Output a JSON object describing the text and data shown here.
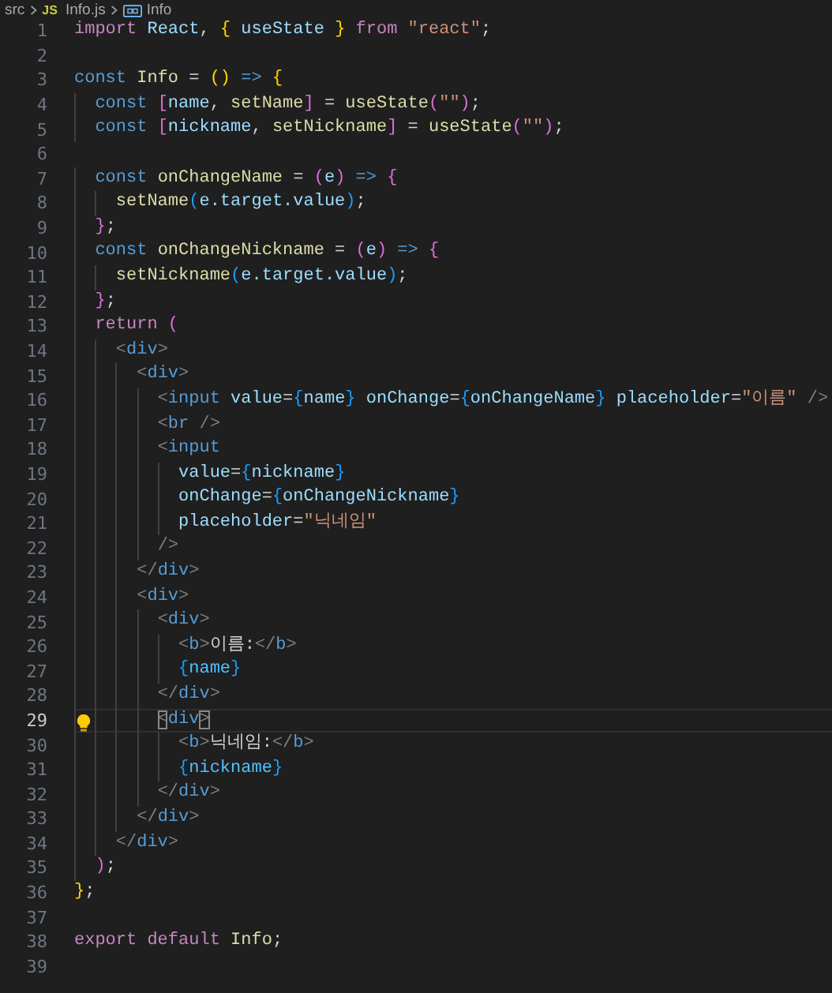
{
  "breadcrumb": {
    "folder": "src",
    "file_badge": "JS",
    "file": "Info.js",
    "symbol": "Info"
  },
  "lines": [
    {
      "n": "1",
      "current": false,
      "tokens": [
        {
          "kind": "kw",
          "text": "import "
        },
        {
          "kind": "var",
          "text": "React"
        },
        {
          "kind": "p",
          "text": ", "
        },
        {
          "kind": "b1",
          "text": "{"
        },
        {
          "kind": "var",
          "text": " useState "
        },
        {
          "kind": "b1",
          "text": "}"
        },
        {
          "kind": "kw",
          "text": " from "
        },
        {
          "kind": "str",
          "text": "\"react\""
        },
        {
          "kind": "p",
          "text": ";"
        }
      ]
    },
    {
      "n": "2",
      "current": false
    },
    {
      "n": "3",
      "current": false,
      "tokens": [
        {
          "kind": "st",
          "text": "const "
        },
        {
          "kind": "fn",
          "text": "Info"
        },
        {
          "kind": "p",
          "text": " = "
        },
        {
          "kind": "b1",
          "text": "()"
        },
        {
          "kind": "st",
          "text": " => "
        },
        {
          "kind": "b1",
          "text": "{"
        }
      ]
    },
    {
      "n": "4",
      "current": false,
      "tokens": [
        {
          "kind": "st",
          "text": "  const "
        },
        {
          "kind": "b2",
          "text": "["
        },
        {
          "kind": "var",
          "text": "name"
        },
        {
          "kind": "p",
          "text": ", "
        },
        {
          "kind": "fn",
          "text": "setName"
        },
        {
          "kind": "b2",
          "text": "]"
        },
        {
          "kind": "p",
          "text": " = "
        },
        {
          "kind": "fn",
          "text": "useState"
        },
        {
          "kind": "b2",
          "text": "("
        },
        {
          "kind": "str",
          "text": "\"\""
        },
        {
          "kind": "b2",
          "text": ")"
        },
        {
          "kind": "p",
          "text": ";"
        }
      ]
    },
    {
      "n": "5",
      "current": false,
      "tokens": [
        {
          "kind": "st",
          "text": "  const "
        },
        {
          "kind": "b2",
          "text": "["
        },
        {
          "kind": "var",
          "text": "nickname"
        },
        {
          "kind": "p",
          "text": ", "
        },
        {
          "kind": "fn",
          "text": "setNickname"
        },
        {
          "kind": "b2",
          "text": "]"
        },
        {
          "kind": "p",
          "text": " = "
        },
        {
          "kind": "fn",
          "text": "useState"
        },
        {
          "kind": "b2",
          "text": "("
        },
        {
          "kind": "str",
          "text": "\"\""
        },
        {
          "kind": "b2",
          "text": ")"
        },
        {
          "kind": "p",
          "text": ";"
        }
      ]
    },
    {
      "n": "6",
      "current": false
    },
    {
      "n": "7",
      "current": false,
      "tokens": [
        {
          "kind": "st",
          "text": "  const "
        },
        {
          "kind": "fn",
          "text": "onChangeName"
        },
        {
          "kind": "p",
          "text": " = "
        },
        {
          "kind": "b2",
          "text": "("
        },
        {
          "kind": "var",
          "text": "e"
        },
        {
          "kind": "b2",
          "text": ")"
        },
        {
          "kind": "st",
          "text": " => "
        },
        {
          "kind": "b2",
          "text": "{"
        }
      ]
    },
    {
      "n": "8",
      "current": false,
      "tokens": [
        {
          "kind": "fn",
          "text": "    setName"
        },
        {
          "kind": "b3",
          "text": "("
        },
        {
          "kind": "var",
          "text": "e.target.value"
        },
        {
          "kind": "b3",
          "text": ")"
        },
        {
          "kind": "p",
          "text": ";"
        }
      ]
    },
    {
      "n": "9",
      "current": false,
      "tokens": [
        {
          "kind": "b2",
          "text": "  }"
        },
        {
          "kind": "p",
          "text": ";"
        }
      ]
    },
    {
      "n": "10",
      "current": false,
      "tokens": [
        {
          "kind": "st",
          "text": "  const "
        },
        {
          "kind": "fn",
          "text": "onChangeNickname"
        },
        {
          "kind": "p",
          "text": " = "
        },
        {
          "kind": "b2",
          "text": "("
        },
        {
          "kind": "var",
          "text": "e"
        },
        {
          "kind": "b2",
          "text": ")"
        },
        {
          "kind": "st",
          "text": " => "
        },
        {
          "kind": "b2",
          "text": "{"
        }
      ]
    },
    {
      "n": "11",
      "current": false,
      "tokens": [
        {
          "kind": "fn",
          "text": "    setNickname"
        },
        {
          "kind": "b3",
          "text": "("
        },
        {
          "kind": "var",
          "text": "e.target.value"
        },
        {
          "kind": "b3",
          "text": ")"
        },
        {
          "kind": "p",
          "text": ";"
        }
      ]
    },
    {
      "n": "12",
      "current": false,
      "tokens": [
        {
          "kind": "b2",
          "text": "  }"
        },
        {
          "kind": "p",
          "text": ";"
        }
      ]
    },
    {
      "n": "13",
      "current": false,
      "tokens": [
        {
          "kind": "kw",
          "text": "  return "
        },
        {
          "kind": "b2",
          "text": "("
        }
      ]
    },
    {
      "n": "14",
      "current": false,
      "tokens": [
        {
          "kind": "tag",
          "text": "    <"
        },
        {
          "kind": "tn",
          "text": "div"
        },
        {
          "kind": "tag",
          "text": ">"
        }
      ]
    },
    {
      "n": "15",
      "current": false,
      "tokens": [
        {
          "kind": "tag",
          "text": "      <"
        },
        {
          "kind": "tn",
          "text": "div"
        },
        {
          "kind": "tag",
          "text": ">"
        }
      ]
    },
    {
      "n": "16",
      "current": false,
      "tokens": [
        {
          "kind": "tag",
          "text": "        <"
        },
        {
          "kind": "tn",
          "text": "input "
        },
        {
          "kind": "attr",
          "text": "value"
        },
        {
          "kind": "p",
          "text": "="
        },
        {
          "kind": "b3",
          "text": "{"
        },
        {
          "kind": "var",
          "text": "name"
        },
        {
          "kind": "b3",
          "text": "}"
        },
        {
          "kind": "attr",
          "text": " onChange"
        },
        {
          "kind": "p",
          "text": "="
        },
        {
          "kind": "b3",
          "text": "{"
        },
        {
          "kind": "var",
          "text": "onChangeName"
        },
        {
          "kind": "b3",
          "text": "}"
        },
        {
          "kind": "attr",
          "text": " placeholder"
        },
        {
          "kind": "p",
          "text": "="
        },
        {
          "kind": "str",
          "text": "\"이름\""
        },
        {
          "kind": "tag",
          "text": " />"
        }
      ]
    },
    {
      "n": "17",
      "current": false,
      "tokens": [
        {
          "kind": "tag",
          "text": "        <"
        },
        {
          "kind": "tn",
          "text": "br"
        },
        {
          "kind": "tag",
          "text": " />"
        }
      ]
    },
    {
      "n": "18",
      "current": false,
      "tokens": [
        {
          "kind": "tag",
          "text": "        <"
        },
        {
          "kind": "tn",
          "text": "input"
        }
      ]
    },
    {
      "n": "19",
      "current": false,
      "tokens": [
        {
          "kind": "attr",
          "text": "          value"
        },
        {
          "kind": "p",
          "text": "="
        },
        {
          "kind": "b3",
          "text": "{"
        },
        {
          "kind": "var",
          "text": "nickname"
        },
        {
          "kind": "b3",
          "text": "}"
        }
      ]
    },
    {
      "n": "20",
      "current": false,
      "tokens": [
        {
          "kind": "attr",
          "text": "          onChange"
        },
        {
          "kind": "p",
          "text": "="
        },
        {
          "kind": "b3",
          "text": "{"
        },
        {
          "kind": "var",
          "text": "onChangeNickname"
        },
        {
          "kind": "b3",
          "text": "}"
        }
      ]
    },
    {
      "n": "21",
      "current": false,
      "tokens": [
        {
          "kind": "attr",
          "text": "          placeholder"
        },
        {
          "kind": "p",
          "text": "="
        },
        {
          "kind": "str",
          "text": "\"닉네임\""
        }
      ]
    },
    {
      "n": "22",
      "current": false,
      "tokens": [
        {
          "kind": "tag",
          "text": "        />"
        }
      ]
    },
    {
      "n": "23",
      "current": false,
      "tokens": [
        {
          "kind": "tag",
          "text": "      </"
        },
        {
          "kind": "tn",
          "text": "div"
        },
        {
          "kind": "tag",
          "text": ">"
        }
      ]
    },
    {
      "n": "24",
      "current": false,
      "tokens": [
        {
          "kind": "tag",
          "text": "      <"
        },
        {
          "kind": "tn",
          "text": "div"
        },
        {
          "kind": "tag",
          "text": ">"
        }
      ]
    },
    {
      "n": "25",
      "current": false,
      "tokens": [
        {
          "kind": "tag",
          "text": "        <"
        },
        {
          "kind": "tn",
          "text": "div"
        },
        {
          "kind": "tag",
          "text": ">"
        }
      ]
    },
    {
      "n": "26",
      "current": false,
      "tokens": [
        {
          "kind": "tag",
          "text": "          <"
        },
        {
          "kind": "tn",
          "text": "b"
        },
        {
          "kind": "tag",
          "text": ">"
        },
        {
          "kind": "p",
          "text": "이름:"
        },
        {
          "kind": "tag",
          "text": "</"
        },
        {
          "kind": "tn",
          "text": "b"
        },
        {
          "kind": "tag",
          "text": ">"
        }
      ]
    },
    {
      "n": "27",
      "current": false,
      "tokens": [
        {
          "kind": "b3",
          "text": "          {"
        },
        {
          "kind": "var2",
          "text": "name"
        },
        {
          "kind": "b3",
          "text": "}"
        }
      ]
    },
    {
      "n": "28",
      "current": false,
      "tokens": [
        {
          "kind": "tag",
          "text": "        </"
        },
        {
          "kind": "tn",
          "text": "div"
        },
        {
          "kind": "tag",
          "text": ">"
        }
      ]
    },
    {
      "n": "29",
      "current": true,
      "tokens": [
        {
          "kind": "match",
          "text": "        <"
        },
        {
          "kind": "tn",
          "text": "div"
        },
        {
          "kind": "match",
          "text": ">"
        }
      ]
    },
    {
      "n": "30",
      "current": false,
      "tokens": [
        {
          "kind": "tag",
          "text": "          <"
        },
        {
          "kind": "tn",
          "text": "b"
        },
        {
          "kind": "tag",
          "text": ">"
        },
        {
          "kind": "p",
          "text": "닉네임:"
        },
        {
          "kind": "tag",
          "text": "</"
        },
        {
          "kind": "tn",
          "text": "b"
        },
        {
          "kind": "tag",
          "text": ">"
        }
      ]
    },
    {
      "n": "31",
      "current": false,
      "tokens": [
        {
          "kind": "b3",
          "text": "          {"
        },
        {
          "kind": "var2",
          "text": "nickname"
        },
        {
          "kind": "b3",
          "text": "}"
        }
      ]
    },
    {
      "n": "32",
      "current": false,
      "tokens": [
        {
          "kind": "tag",
          "text": "        </"
        },
        {
          "kind": "tn",
          "text": "div"
        },
        {
          "kind": "tag",
          "text": ">"
        }
      ]
    },
    {
      "n": "33",
      "current": false,
      "tokens": [
        {
          "kind": "tag",
          "text": "      </"
        },
        {
          "kind": "tn",
          "text": "div"
        },
        {
          "kind": "tag",
          "text": ">"
        }
      ]
    },
    {
      "n": "34",
      "current": false,
      "tokens": [
        {
          "kind": "tag",
          "text": "    </"
        },
        {
          "kind": "tn",
          "text": "div"
        },
        {
          "kind": "tag",
          "text": ">"
        }
      ]
    },
    {
      "n": "35",
      "current": false,
      "tokens": [
        {
          "kind": "b2",
          "text": "  )"
        },
        {
          "kind": "p",
          "text": ";"
        }
      ]
    },
    {
      "n": "36",
      "current": false,
      "tokens": [
        {
          "kind": "b1",
          "text": "}"
        },
        {
          "kind": "p",
          "text": ";"
        }
      ]
    },
    {
      "n": "37",
      "current": false
    },
    {
      "n": "38",
      "current": false,
      "tokens": [
        {
          "kind": "kw",
          "text": "export default "
        },
        {
          "kind": "fn",
          "text": "Info"
        },
        {
          "kind": "p",
          "text": ";"
        }
      ]
    },
    {
      "n": "39",
      "current": false
    }
  ]
}
